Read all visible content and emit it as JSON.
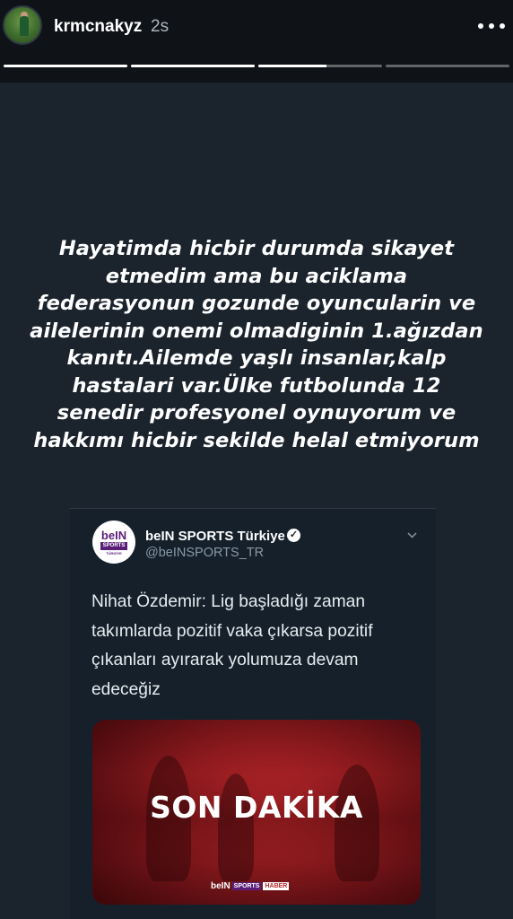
{
  "header": {
    "username": "krmcnakyz",
    "time": "2s",
    "more_icon": "more-horizontal-icon"
  },
  "progress": [
    1,
    1,
    0.55,
    0
  ],
  "caption": {
    "lines": [
      "Hayatimda hicbir durumda sikayet",
      "etmedim ama bu aciklama",
      "federasyonun gozunde oyuncularin ve",
      "ailelerinin onemi olmadiginin 1.ağızdan",
      "kanıtı.Ailemde yaşlı insanlar,kalp",
      "hastalari var.Ülke futbolunda 12",
      "senedir profesyonel oynuyorum ve",
      "hakkımı hicbir sekilde helal etmiyorum"
    ]
  },
  "tweet": {
    "avatar_logo": "beIN",
    "avatar_badge": "SPORTS",
    "avatar_sub": "TÜRKİYE",
    "name": "beIN SPORTS Türkiye",
    "handle": "@beINSPORTS_TR",
    "verified_icon": "verified-badge-icon",
    "text": "Nihat Özdemir: Lig başladığı zaman takımlarda pozitif vaka çıkarsa pozitif çıkanları ayırarak yolumuza devam edeceğiz",
    "media": {
      "headline": "SON DAKİKA",
      "brand_1": "beIN",
      "brand_2": "SPORTS",
      "brand_3": "HABER"
    }
  },
  "colors": {
    "background": "#1b232d",
    "tweet_background": "#15202b",
    "accent_red": "#b8262a",
    "brand_purple": "#5a1e78"
  }
}
